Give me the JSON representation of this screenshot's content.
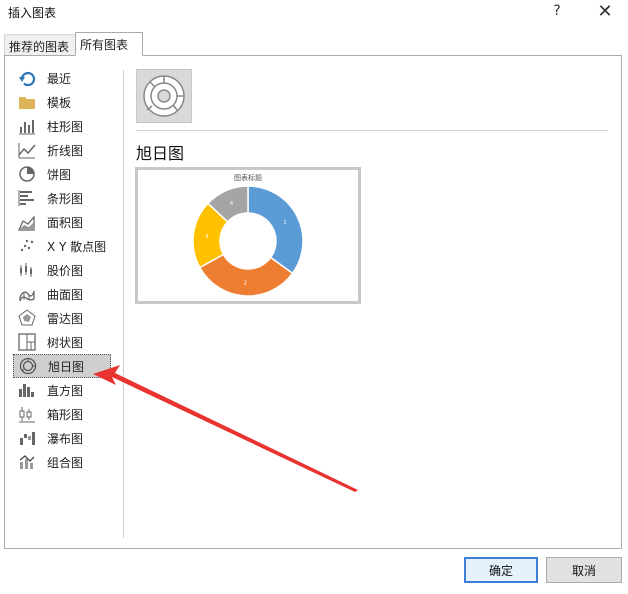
{
  "window": {
    "title": "插入图表",
    "help_label": "?",
    "close_label": "✕"
  },
  "tabs": [
    {
      "label": "推荐的图表"
    },
    {
      "label": "所有图表"
    }
  ],
  "sidebar": {
    "items": [
      {
        "label": "最近",
        "icon": "recent-icon"
      },
      {
        "label": "模板",
        "icon": "folder-icon"
      },
      {
        "label": "柱形图",
        "icon": "column-chart-icon"
      },
      {
        "label": "折线图",
        "icon": "line-chart-icon"
      },
      {
        "label": "饼图",
        "icon": "pie-chart-icon"
      },
      {
        "label": "条形图",
        "icon": "bar-chart-icon"
      },
      {
        "label": "面积图",
        "icon": "area-chart-icon"
      },
      {
        "label": "X Y 散点图",
        "icon": "scatter-chart-icon"
      },
      {
        "label": "股价图",
        "icon": "stock-chart-icon"
      },
      {
        "label": "曲面图",
        "icon": "surface-chart-icon"
      },
      {
        "label": "雷达图",
        "icon": "radar-chart-icon"
      },
      {
        "label": "树状图",
        "icon": "treemap-chart-icon"
      },
      {
        "label": "旭日图",
        "icon": "sunburst-chart-icon",
        "selected": true
      },
      {
        "label": "直方图",
        "icon": "histogram-chart-icon"
      },
      {
        "label": "箱形图",
        "icon": "boxwhisker-chart-icon"
      },
      {
        "label": "瀑布图",
        "icon": "waterfall-chart-icon"
      },
      {
        "label": "组合图",
        "icon": "combo-chart-icon"
      }
    ]
  },
  "main": {
    "chart_name": "旭日图",
    "preview_title": "图表标题",
    "segments": [
      {
        "label": "1",
        "value": 35,
        "color": "#5b9bd5"
      },
      {
        "label": "2",
        "value": 32,
        "color": "#ed7d31"
      },
      {
        "label": "3",
        "value": 20,
        "color": "#ffc000"
      },
      {
        "label": "4",
        "value": 13,
        "color": "#a5a5a5"
      }
    ]
  },
  "buttons": {
    "ok_label": "确定",
    "cancel_label": "取消"
  },
  "colors": {
    "accent": "#3c7fd5",
    "arrow": "#e8332f",
    "selected_bg": "#cfcfcf"
  }
}
